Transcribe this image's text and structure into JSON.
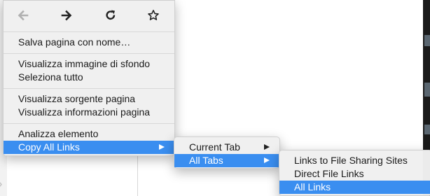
{
  "nav": {
    "icons": [
      "back-arrow-icon",
      "forward-arrow-icon",
      "reload-icon",
      "bookmark-star-icon"
    ]
  },
  "context_menu": {
    "save_page_as": "Salva pagina con nome…",
    "view_background_image": "Visualizza immagine di sfondo",
    "select_all": "Seleziona tutto",
    "view_page_source": "Visualizza sorgente pagina",
    "view_page_info": "Visualizza informazioni pagina",
    "inspect_element": "Analizza elemento",
    "copy_all_links": "Copy All Links"
  },
  "submenu_tabs": {
    "current_tab": "Current Tab",
    "all_tabs": "All Tabs"
  },
  "submenu_links": {
    "file_sharing_links": "Links to File Sharing Sites",
    "direct_file_links": "Direct File Links",
    "all_links": "All Links"
  },
  "colors": {
    "highlight": "#3a8ef0",
    "menu_background": "#f0f0f0"
  }
}
